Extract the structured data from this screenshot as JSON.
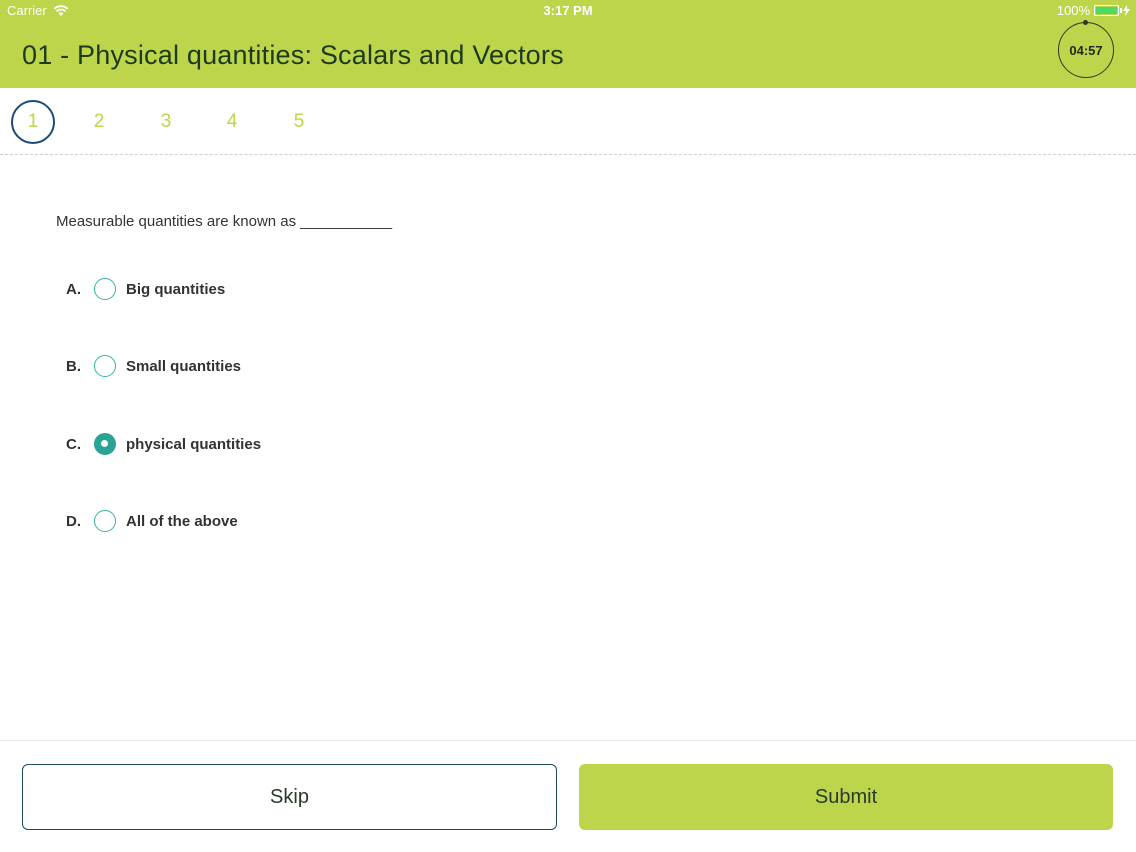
{
  "status_bar": {
    "carrier": "Carrier",
    "time": "3:17 PM",
    "battery": "100%"
  },
  "header": {
    "title": "01 - Physical quantities: Scalars and Vectors",
    "timer": "04:57"
  },
  "question_nav": [
    "1",
    "2",
    "3",
    "4",
    "5"
  ],
  "question": {
    "text": "Measurable quantities are known as ___________"
  },
  "options": [
    {
      "letter": "A.",
      "label": "Big quantities",
      "selected": false
    },
    {
      "letter": "B.",
      "label": "Small quantities",
      "selected": false
    },
    {
      "letter": "C.",
      "label": "physical quantities",
      "selected": true
    },
    {
      "letter": "D.",
      "label": "All of the above",
      "selected": false
    }
  ],
  "buttons": {
    "skip": "Skip",
    "submit": "Submit"
  },
  "colors": {
    "accent": "#bcd54a",
    "radio": "#2aa394",
    "active_nav": "#1c4a7a"
  }
}
